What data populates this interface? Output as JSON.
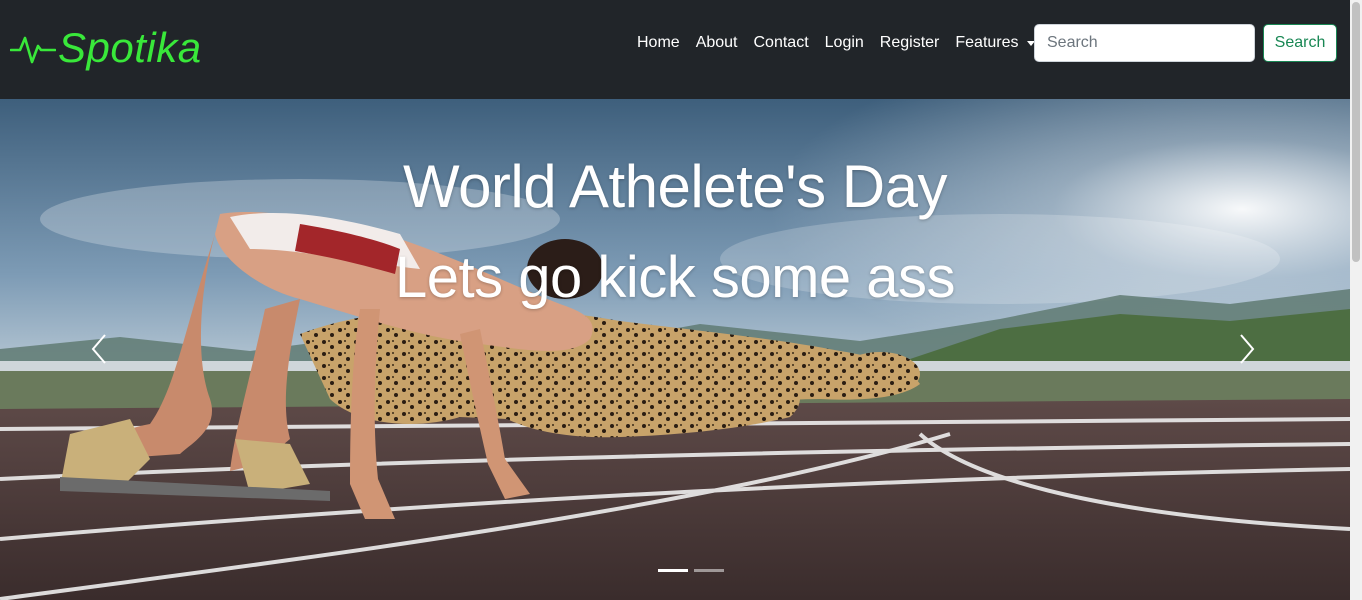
{
  "brand": {
    "name": "Spotika",
    "color": "#39e83a",
    "icon": "heartbeat-icon"
  },
  "nav": {
    "items": [
      {
        "label": "Home"
      },
      {
        "label": "About"
      },
      {
        "label": "Contact"
      },
      {
        "label": "Login"
      },
      {
        "label": "Register"
      },
      {
        "label": "Features"
      }
    ]
  },
  "search": {
    "placeholder": "Search",
    "button_label": "Search",
    "accent": "#198754"
  },
  "carousel": {
    "title": "World Athelete's Day",
    "subtitle": "Lets go kick some ass",
    "prev_icon": "chevron-left-icon",
    "next_icon": "chevron-right-icon",
    "slide_count": 2,
    "active_slide": 0
  },
  "colors": {
    "navbar_bg": "#212529",
    "text": "#ffffff"
  }
}
